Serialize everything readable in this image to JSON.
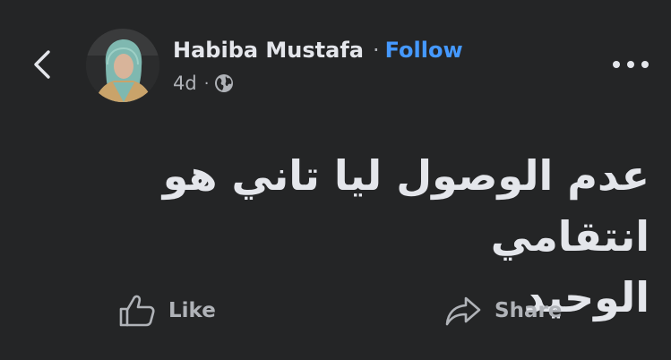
{
  "header": {
    "back_icon": "chevron-left-icon",
    "author_name": "Habiba Mustafa",
    "separator": "·",
    "follow_label": "Follow",
    "time": "4d",
    "meta_separator": "·",
    "audience_icon": "globe-icon",
    "more_icon": "more-dots-icon"
  },
  "post": {
    "text_line_1": "عدم الوصول ليا تاني هو انتقامي",
    "text_line_2": "الوحيد"
  },
  "actions": {
    "like_label": "Like",
    "like_icon": "thumbs-up-icon",
    "share_label": "Share",
    "share_icon": "share-arrow-icon"
  },
  "colors": {
    "background": "#242526",
    "primary_text": "#e4e6eb",
    "secondary_text": "#b0b3b8",
    "follow_blue": "#4599ff"
  }
}
